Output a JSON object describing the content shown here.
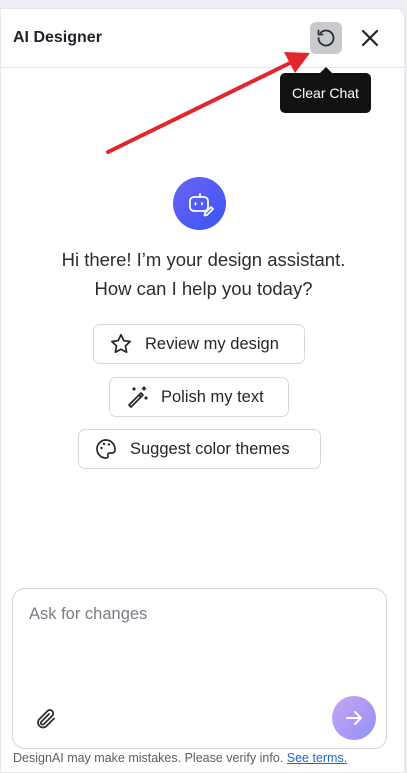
{
  "header": {
    "title": "AI Designer",
    "refresh_icon": "refresh-icon",
    "close_icon": "close-icon"
  },
  "tooltip": {
    "text": "Clear Chat"
  },
  "welcome": {
    "avatar_icon": "bot-edit-icon",
    "line1": "Hi there! I’m your design assistant.",
    "line2": "How can I help you today?"
  },
  "suggestions": [
    {
      "label": "Review my design",
      "icon": "star-icon"
    },
    {
      "label": "Polish my text",
      "icon": "magic-wand-icon"
    },
    {
      "label": "Suggest color themes",
      "icon": "palette-icon"
    }
  ],
  "composer": {
    "placeholder": "Ask for changes",
    "value": "",
    "attach_icon": "paperclip-icon",
    "send_icon": "arrow-right-icon"
  },
  "footer": {
    "disclaimer": "DesignAI may make mistakes. Please verify info.",
    "terms_link": "See terms."
  },
  "colors": {
    "accent_gradient_start": "#6b63f6",
    "accent_gradient_end": "#3a55f2",
    "annotation_arrow": "#e3262b",
    "link": "#1a66d2"
  }
}
